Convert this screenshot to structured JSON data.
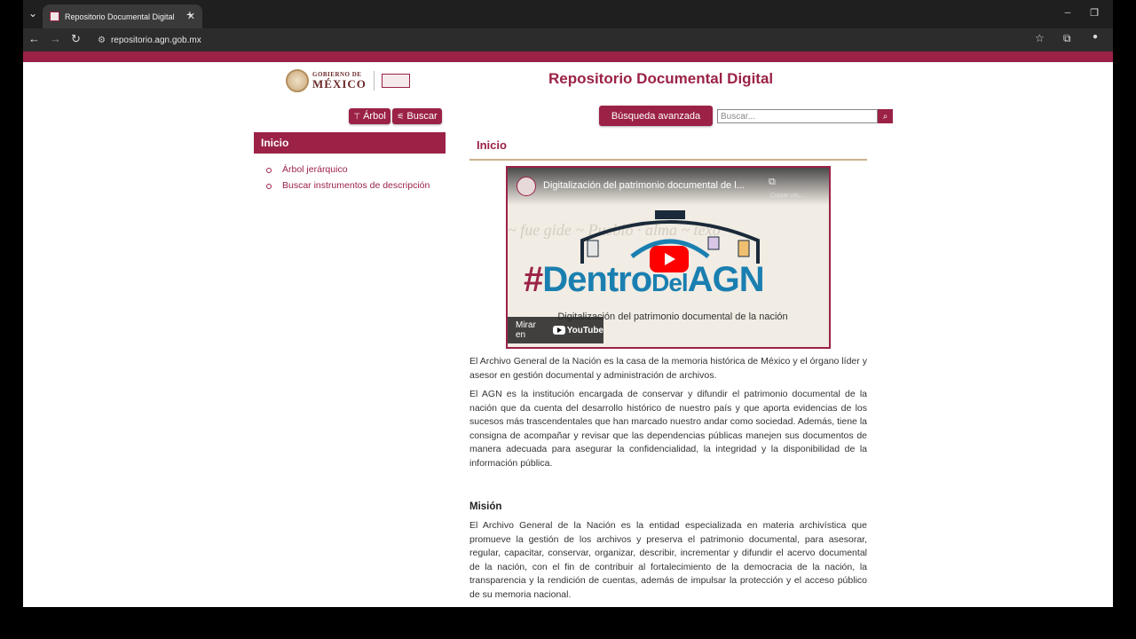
{
  "browser": {
    "tab_title": "Repositorio Documental Digital",
    "tab_close": "✕",
    "new_tab": "+",
    "url": "repositorio.agn.gob.mx",
    "win_min": "─",
    "win_max": "❐",
    "back": "←",
    "forward": "→",
    "reload": "↻",
    "bookmark": "☆",
    "extensions": "⧉",
    "profile": "●",
    "tab_menu": "⌄"
  },
  "header": {
    "gob_line1": "GOBIERNO DE",
    "gob_line2": "MÉXICO",
    "title": "Repositorio Documental Digital"
  },
  "toolbar": {
    "arbol_label": "Árbol",
    "buscar_label": "Buscar",
    "advanced_label": "Búsqueda avanzada",
    "search_placeholder": "Buscar...",
    "search_icon": "search-icon"
  },
  "sidebar": {
    "header": "Inicio",
    "items": [
      {
        "label": "Árbol jerárquico"
      },
      {
        "label": "Buscar instrumentos de descripción"
      }
    ]
  },
  "main": {
    "title": "Inicio",
    "video": {
      "title": "Digitalización del patrimonio documental de l...",
      "copy_label": "Copiar vín...",
      "hashtag_hash": "#",
      "hashtag_a": "Dentro",
      "hashtag_b": "Del",
      "hashtag_c": "AGN",
      "subtitle": "Digitalización del patrimonio documental de la nación",
      "watch_on": "Mirar en",
      "youtube": "YouTube"
    },
    "paragraphs": [
      "El Archivo General de la Nación es la casa de la memoria histórica de México y el órgano líder y asesor en gestión documental y administración de archivos.",
      "El AGN es la institución encargada de conservar y difundir el patrimonio documental de la nación que da cuenta del desarrollo histórico de nuestro país y que aporta evidencias de los sucesos más trascendentales que han marcado nuestro andar como sociedad. Además, tiene la consigna de acompañar y revisar que las dependencias públicas manejen sus documentos de manera adecuada para asegurar la confidencialidad, la integridad y la disponibilidad de la información pública."
    ],
    "mision_title": "Misión",
    "mision_text": "El Archivo General de la Nación es la entidad especializada en materia archivística que promueve la gestión de los archivos y preserva el patrimonio documental, para asesorar, regular, capacitar, conservar, organizar, describir, incrementar y difundir el acervo documental de la nación, con el fin de contribuir al fortalecimiento de la democracia de la nación, la transparencia y la rendición de cuentas, además de impulsar la protección y el acceso público de su memoria nacional."
  },
  "colors": {
    "brand": "#9b2246",
    "accent_gold": "#b38e5d",
    "youtube_red": "#ff0000",
    "hashtag_blue": "#1a7fb0"
  }
}
